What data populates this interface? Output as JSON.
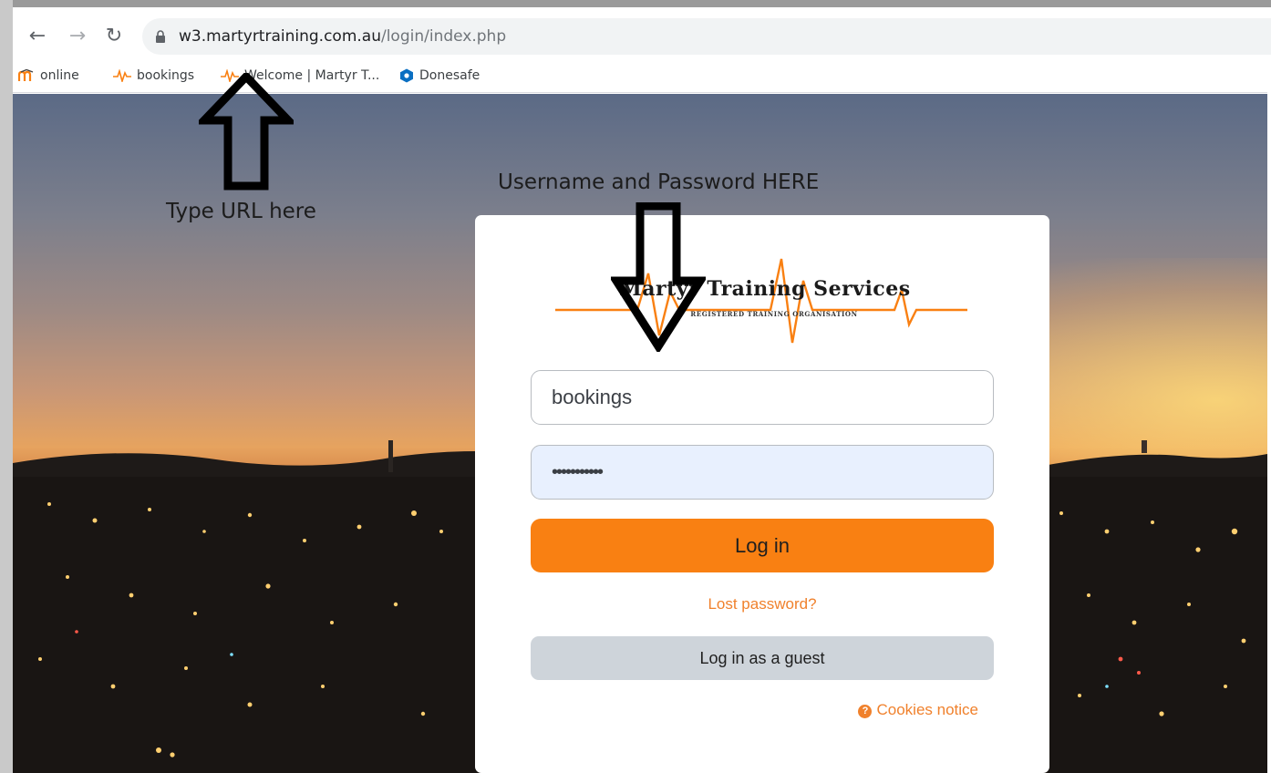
{
  "browser": {
    "url_domain": "w3.martyrtraining.com.au",
    "url_path": "/login/index.php",
    "bookmarks": [
      {
        "label": "online",
        "icon": "moodle-m-icon"
      },
      {
        "label": "bookings",
        "icon": "pulse-icon"
      },
      {
        "label": "Welcome | Martyr T...",
        "icon": "pulse-icon"
      },
      {
        "label": "Donesafe",
        "icon": "donesafe-hex-icon"
      }
    ],
    "colors": {
      "accent_blue": "#0a6fc2",
      "moodle_orange": "#f98012"
    }
  },
  "annotations": {
    "url_hint": "Type URL here",
    "credentials_hint": "Username and Password HERE"
  },
  "login": {
    "logo_title": "Martyr Training Services",
    "logo_subtitle": "REGISTERED TRAINING ORGANISATION",
    "username_value": "bookings",
    "password_value": "•••••••••••",
    "login_button": "Log in",
    "lost_password": "Lost password?",
    "guest_button": "Log in as a guest",
    "cookies_notice": "Cookies notice",
    "colors": {
      "primary": "#f98012",
      "link": "#f0812c",
      "guest_bg": "#ced4da",
      "autofill_bg": "#e8f0fe"
    }
  }
}
